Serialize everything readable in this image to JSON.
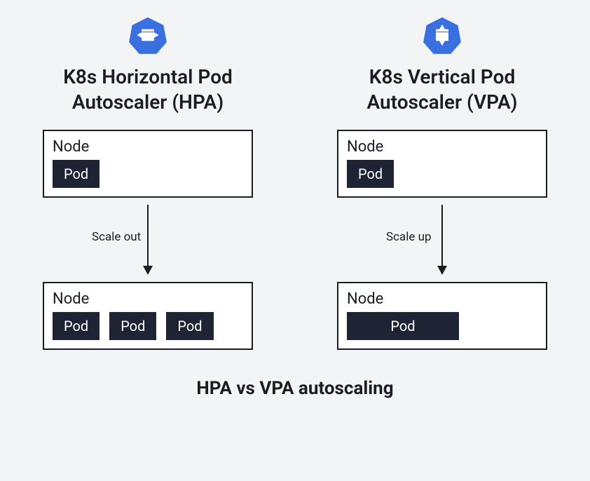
{
  "caption": "HPA vs VPA autoscaling",
  "columns": {
    "hpa": {
      "title": "K8s Horizontal Pod\nAutoscaler (HPA)",
      "arrowLabel": "Scale out",
      "before": {
        "nodeLabel": "Node",
        "pods": [
          "Pod"
        ]
      },
      "after": {
        "nodeLabel": "Node",
        "pods": [
          "Pod",
          "Pod",
          "Pod"
        ]
      }
    },
    "vpa": {
      "title": "K8s Vertical Pod\nAutoscaler (VPA)",
      "arrowLabel": "Scale up",
      "before": {
        "nodeLabel": "Node",
        "pods": [
          "Pod"
        ]
      },
      "after": {
        "nodeLabel": "Node",
        "pods": [
          "Pod"
        ],
        "widePod": true
      }
    }
  }
}
